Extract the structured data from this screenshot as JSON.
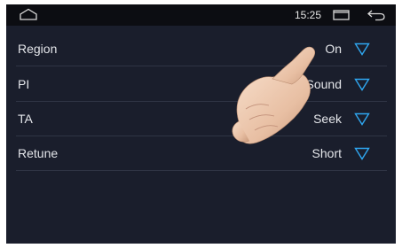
{
  "statusbar": {
    "time": "15:25",
    "icons": [
      "home-icon",
      "window-icon",
      "back-icon"
    ]
  },
  "settings": {
    "rows": [
      {
        "label": "Region",
        "value": "On"
      },
      {
        "label": "PI",
        "value": "Sound"
      },
      {
        "label": "TA",
        "value": "Seek"
      },
      {
        "label": "Retune",
        "value": "Short"
      }
    ]
  },
  "colors": {
    "background": "#1a1e2c",
    "statusbar": "#0c0d12",
    "accent": "#2fa8f2",
    "text": "#e4e6ea"
  }
}
